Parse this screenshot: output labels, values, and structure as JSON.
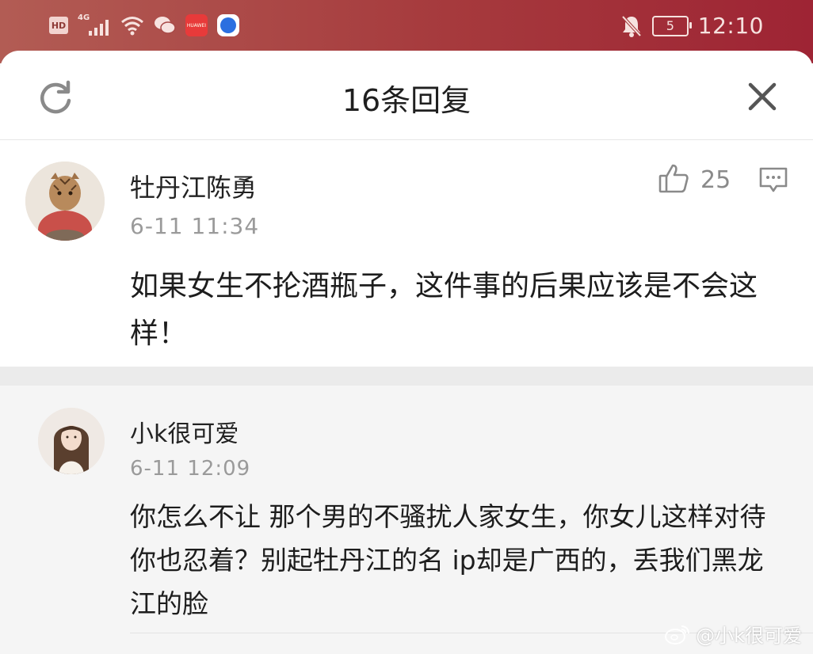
{
  "status_bar": {
    "hd": "HD",
    "network": "4G",
    "app_label": "HUAWEI",
    "battery": "5",
    "time": "12:10"
  },
  "header": {
    "title": "16条回复"
  },
  "main_comment": {
    "username": "牡丹江陈勇",
    "time": "6-11 11:34",
    "likes": "25",
    "content": "如果女生不抡酒瓶子，这件事的后果应该是不会这样！"
  },
  "reply_comment": {
    "username": "小k很可爱",
    "time": "6-11 12:09",
    "content": "你怎么不让 那个男的不骚扰人家女生，你女儿这样对待你也忍着？别起牡丹江的名 ip却是广西的，丢我们黑龙江的脸"
  },
  "watermark": {
    "text": "@小k很可爱"
  },
  "colors": {
    "status_gradient_start": "#b25c54",
    "status_gradient_end": "#9e2434",
    "sheet_bg": "#ffffff",
    "reply_bg": "#f5f5f5",
    "meta_text": "#9a9a9a"
  }
}
